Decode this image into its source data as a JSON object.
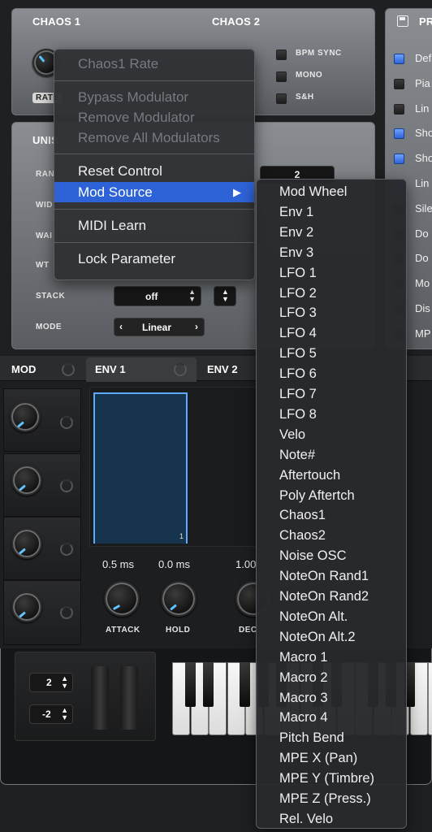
{
  "chaos": {
    "chaos1_title": "CHAOS 1",
    "chaos2_title": "CHAOS 2",
    "rate_label": "RATE",
    "options": [
      {
        "label": "BPM SYNC",
        "checked": false
      },
      {
        "label": "MONO",
        "checked": false
      },
      {
        "label": "S&H",
        "checked": false
      }
    ]
  },
  "prefs": {
    "title": "PR",
    "items": [
      {
        "label": "Def",
        "checked": true
      },
      {
        "label": "Pia",
        "checked": false
      },
      {
        "label": "Lin",
        "checked": false
      },
      {
        "label": "Sho",
        "checked": true
      },
      {
        "label": "Sho",
        "checked": true
      },
      {
        "label": "Lin",
        "checked": true
      },
      {
        "label": "Sile",
        "checked": false
      },
      {
        "label": "Do",
        "checked": false
      },
      {
        "label": "Do",
        "checked": false
      },
      {
        "label": "Mo",
        "checked": false
      },
      {
        "label": "Dis",
        "checked": false
      },
      {
        "label": "MP",
        "checked": false
      }
    ]
  },
  "unison": {
    "title": "UNIS",
    "rows": [
      "RAN",
      "WID",
      "WAI",
      "WT"
    ],
    "right_value": "2",
    "stack_label": "STACK",
    "stack_value": "off",
    "mode_label": "MODE",
    "mode_value": "Linear"
  },
  "mod_panel": {
    "mod_tab": "MOD",
    "env1_tab": "ENV 1",
    "env2_tab": "ENV 2",
    "env_point_label": "1",
    "attack_value": "0.5 ms",
    "hold_value": "0.0 ms",
    "decay_value": "1.00",
    "attack_label": "ATTACK",
    "hold_label": "HOLD",
    "decay_label": "DEC"
  },
  "keyboard": {
    "pitch_up": "2",
    "pitch_down": "-2"
  },
  "context_menu": {
    "title": "Chaos1 Rate",
    "bypass": "Bypass Modulator",
    "remove": "Remove Modulator",
    "remove_all": "Remove All Modulators",
    "reset": "Reset Control",
    "mod_source": "Mod Source",
    "submenu_arrow": "▶",
    "midi_learn": "MIDI Learn",
    "lock": "Lock Parameter"
  },
  "mod_source_menu": [
    "Mod Wheel",
    "Env 1",
    "Env 2",
    "Env 3",
    "LFO 1",
    "LFO 2",
    "LFO 3",
    "LFO 4",
    "LFO 5",
    "LFO 6",
    "LFO 7",
    "LFO 8",
    "Velo",
    "Note#",
    "Aftertouch",
    "Poly Aftertch",
    "Chaos1",
    "Chaos2",
    "Noise OSC",
    "NoteOn Rand1",
    "NoteOn Rand2",
    "NoteOn Alt.",
    "NoteOn Alt.2",
    "Macro 1",
    "Macro 2",
    "Macro 3",
    "Macro 4",
    "Pitch Bend",
    "MPE X (Pan)",
    "MPE Y (Timbre)",
    "MPE Z (Press.)",
    "Rel. Velo"
  ]
}
